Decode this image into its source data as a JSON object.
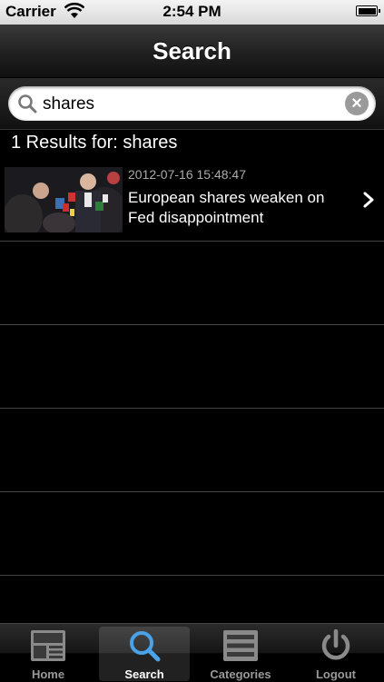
{
  "status_bar": {
    "carrier": "Carrier",
    "time": "2:54 PM"
  },
  "nav": {
    "title": "Search"
  },
  "search": {
    "value": "shares",
    "placeholder": ""
  },
  "results": {
    "header": "1 Results for: shares",
    "items": [
      {
        "date": "2012-07-16 15:48:47",
        "headline": "European shares weaken on Fed disappointment"
      }
    ]
  },
  "tabs": [
    {
      "label": "Home",
      "icon": "home-icon",
      "active": false
    },
    {
      "label": "Search",
      "icon": "search-icon",
      "active": true
    },
    {
      "label": "Categories",
      "icon": "list-icon",
      "active": false
    },
    {
      "label": "Logout",
      "icon": "power-icon",
      "active": false
    }
  ],
  "colors": {
    "accent": "#4aa3e8",
    "background": "#000000"
  }
}
